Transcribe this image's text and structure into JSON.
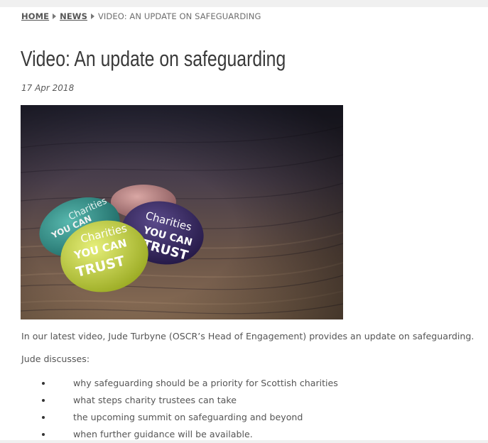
{
  "breadcrumb": {
    "home": "HOME",
    "news": "NEWS",
    "current": "VIDEO: AN UPDATE ON SAFEGUARDING"
  },
  "article": {
    "title": "Video: An update on safeguarding",
    "date": "17 Apr 2018",
    "image": {
      "badges": [
        {
          "line1": "Charities",
          "line2": "YOU CAN",
          "line3": "TRUST",
          "color": "#c5d53a"
        },
        {
          "line1": "Charities",
          "line2": "YOU CAN",
          "line3": "TRUST",
          "color": "#3b2a66"
        },
        {
          "line1": "Charities",
          "line2": "YOU CAN",
          "line3": "TRUST",
          "color": "#2f8f88"
        }
      ]
    },
    "intro": "In our latest video, Jude Turbyne (OSCR’s Head of Engagement) provides an update on safeguarding.",
    "discusses": "Jude discusses:",
    "points": [
      "why safeguarding should be a priority for Scottish charities",
      "what steps charity trustees can take",
      "the upcoming summit on safeguarding and beyond",
      "when further guidance will be available."
    ]
  }
}
